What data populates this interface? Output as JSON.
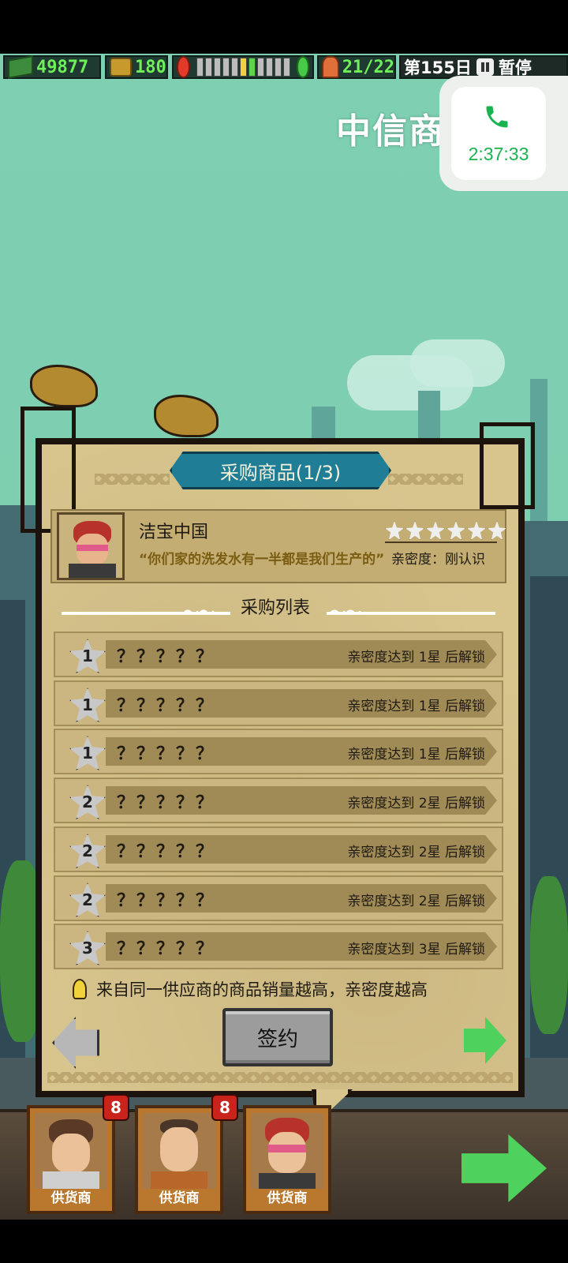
{
  "hud": {
    "cash": "49877",
    "coins": "180",
    "staff": "21/22",
    "day": "第155日",
    "pause": "暂停"
  },
  "location_title": "中信商",
  "call": {
    "time": "2:37:33"
  },
  "dialog": {
    "title": "采购商品(1/3)",
    "supplier": {
      "name": "洁宝中国",
      "quote": "“你们家的洗发水有一半都是我们生产的”",
      "rating_stars": 6,
      "intimacy": "亲密度：刚认识"
    },
    "list_header": "采购列表",
    "items": [
      {
        "star": "1",
        "name": "？？？？？",
        "lock": "亲密度达到 1星 后解锁"
      },
      {
        "star": "1",
        "name": "？？？？？",
        "lock": "亲密度达到 1星 后解锁"
      },
      {
        "star": "1",
        "name": "？？？？？",
        "lock": "亲密度达到 1星 后解锁"
      },
      {
        "star": "2",
        "name": "？？？？？",
        "lock": "亲密度达到 2星 后解锁"
      },
      {
        "star": "2",
        "name": "？？？？？",
        "lock": "亲密度达到 2星 后解锁"
      },
      {
        "star": "2",
        "name": "？？？？？",
        "lock": "亲密度达到 2星 后解锁"
      },
      {
        "star": "3",
        "name": "？？？？？",
        "lock": "亲密度达到 3星 后解锁"
      }
    ],
    "tip": "来自同一供应商的商品销量越高，亲密度越高",
    "sign_button": "签约"
  },
  "supplier_tabs": [
    {
      "label": "供货商",
      "badge": "8"
    },
    {
      "label": "供货商",
      "badge": "8"
    },
    {
      "label": "供货商",
      "badge": ""
    }
  ],
  "colors": {
    "accent": "#1f7d95",
    "cash": "#6ff05a",
    "call": "#19b34f",
    "next": "#4fd25d"
  }
}
